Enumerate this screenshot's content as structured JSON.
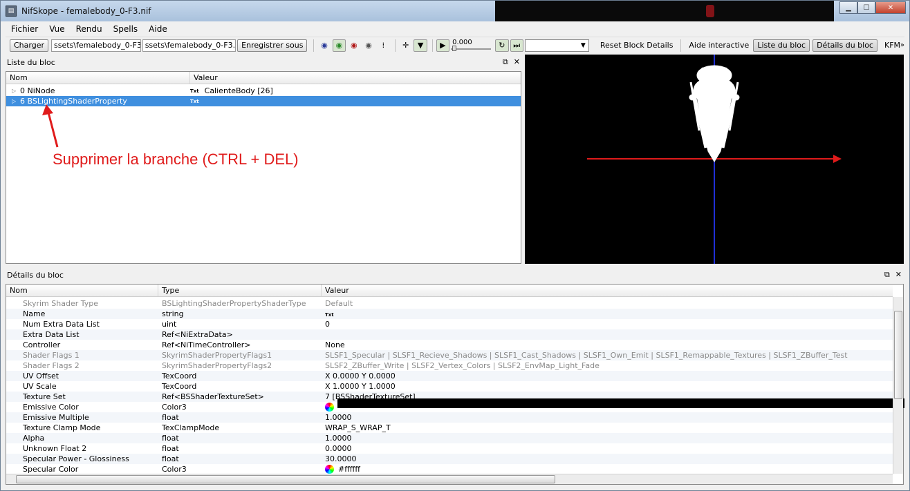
{
  "window": {
    "title": "NifSkope - femalebody_0-F3.nif"
  },
  "menu": [
    "Fichier",
    "Vue",
    "Rendu",
    "Spells",
    "Aide"
  ],
  "toolbar": {
    "load_button": "Charger",
    "path1": "ssets\\femalebody_0-F3.nif",
    "path2": "ssets\\femalebody_0-F3.nif",
    "save_as_button": "Enregistrer sous",
    "time_value": "0.000",
    "reset_block_details": "Reset Block Details",
    "interactive_help": "Aide interactive",
    "block_list_toggle": "Liste du bloc",
    "block_details_toggle": "Détails du bloc",
    "kfm": "KFM"
  },
  "block_list": {
    "title": "Liste du bloc",
    "columns": [
      "Nom",
      "Valeur"
    ],
    "rows": [
      {
        "name": "0 NiNode",
        "type_icon": "Txt",
        "value": "CalienteBody [26]"
      },
      {
        "name": "6 BSLightingShaderProperty",
        "type_icon": "Txt",
        "value": ""
      }
    ]
  },
  "annotation": {
    "text": "Supprimer la branche (CTRL + DEL)",
    "color": "#e01b1b"
  },
  "block_details": {
    "title": "Détails du bloc",
    "columns": [
      "Nom",
      "Type",
      "Valeur"
    ],
    "rows": [
      {
        "name": "Skyrim Shader Type",
        "type": "BSLightingShaderPropertyShaderType",
        "value": "Default",
        "disabled": true
      },
      {
        "name": "Name",
        "type": "string",
        "value": "Txt"
      },
      {
        "name": "Num Extra Data List",
        "type": "uint",
        "value": "0"
      },
      {
        "name": "Extra Data List",
        "type": "Ref<NiExtraData>",
        "value": ""
      },
      {
        "name": "Controller",
        "type": "Ref<NiTimeController>",
        "value": "None"
      },
      {
        "name": "Shader Flags 1",
        "type": "SkyrimShaderPropertyFlags1",
        "value": "SLSF1_Specular | SLSF1_Recieve_Shadows | SLSF1_Cast_Shadows | SLSF1_Own_Emit | SLSF1_Remappable_Textures | SLSF1_ZBuffer_Test",
        "disabled": true
      },
      {
        "name": "Shader Flags 2",
        "type": "SkyrimShaderPropertyFlags2",
        "value": "SLSF2_ZBuffer_Write | SLSF2_Vertex_Colors | SLSF2_EnvMap_Light_Fade",
        "disabled": true
      },
      {
        "name": "UV Offset",
        "type": "TexCoord",
        "value": "X 0.0000 Y 0.0000"
      },
      {
        "name": "UV Scale",
        "type": "TexCoord",
        "value": "X 1.0000 Y 1.0000"
      },
      {
        "name": "Texture Set",
        "type": "Ref<BSShaderTextureSet>",
        "value": "7 [BSShaderTextureSet]"
      },
      {
        "name": "Emissive Color",
        "type": "Color3",
        "value": "",
        "color_swatch": true,
        "color_bar": "#000000"
      },
      {
        "name": "Emissive Multiple",
        "type": "float",
        "value": "1.0000"
      },
      {
        "name": "Texture Clamp Mode",
        "type": "TexClampMode",
        "value": "WRAP_S_WRAP_T"
      },
      {
        "name": "Alpha",
        "type": "float",
        "value": "1.0000"
      },
      {
        "name": "Unknown Float 2",
        "type": "float",
        "value": "0.0000"
      },
      {
        "name": "Specular Power - Glossiness",
        "type": "float",
        "value": "30.0000"
      },
      {
        "name": "Specular Color",
        "type": "Color3",
        "value": "#ffffff",
        "color_swatch": true
      }
    ]
  },
  "colors": {
    "selection": "#3f8fdf",
    "viewport_bg": "#000000",
    "x_axis": "#e01b1b",
    "y_axis": "#1f2fd6"
  }
}
